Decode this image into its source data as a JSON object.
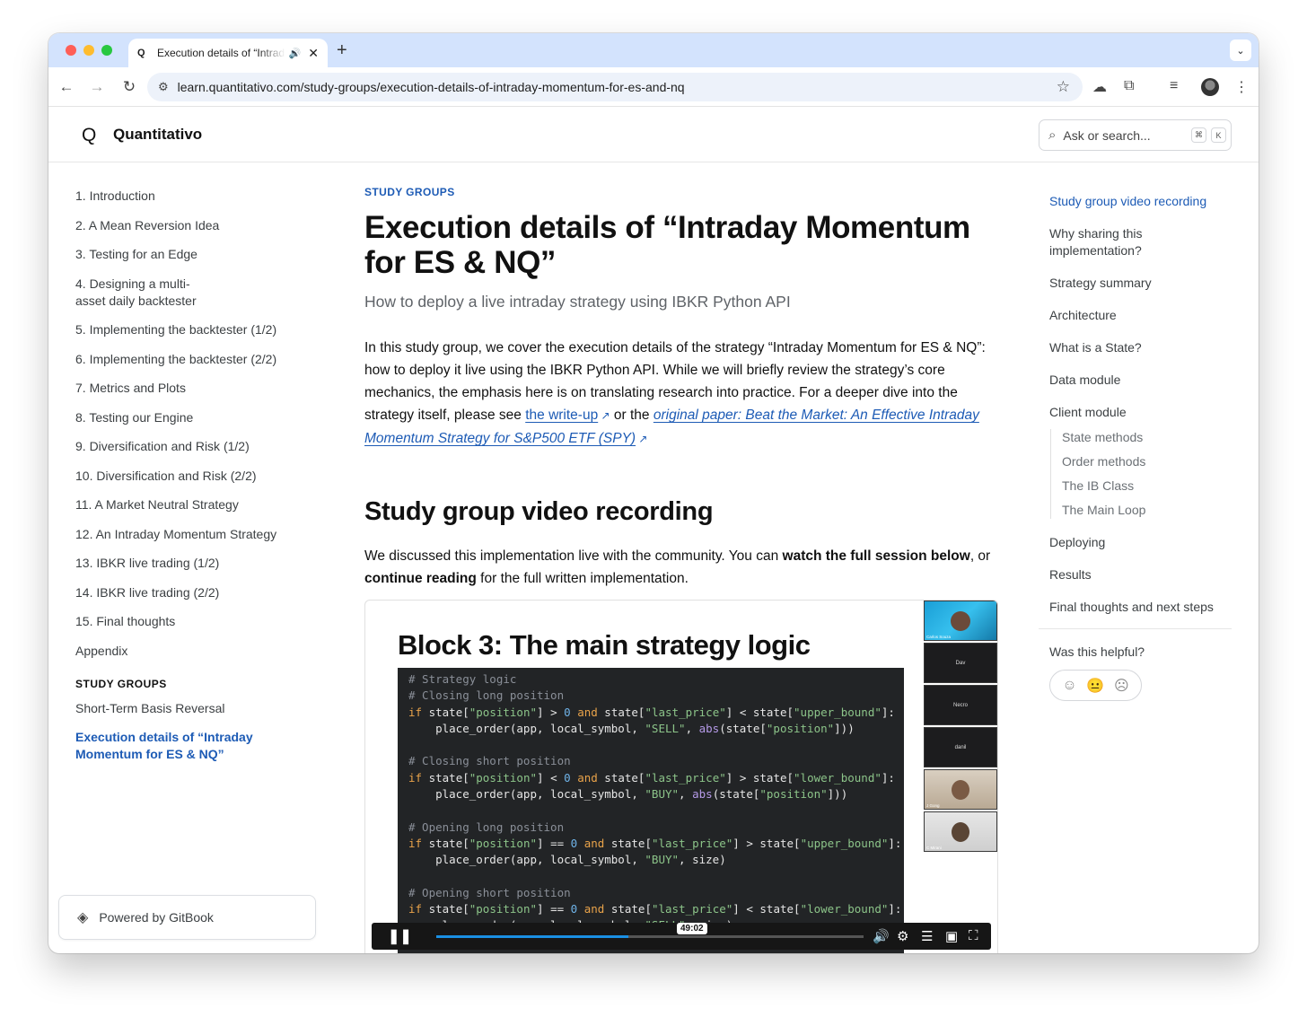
{
  "browser": {
    "tab_favicon": "Q",
    "tab_title": "Execution details of “Intraday Momentum",
    "url": "learn.quantitativo.com/study-groups/execution-details-of-intraday-momentum-for-es-and-nq",
    "icons": [
      "back-icon",
      "forward-icon",
      "reload-icon",
      "tune-icon",
      "star-icon",
      "cloud-icon",
      "extensions-icon",
      "media-icon",
      "profile-avatar",
      "menu-icon"
    ]
  },
  "site": {
    "logo": "Q",
    "name": "Quantitativo",
    "search_placeholder": "Ask or search...",
    "shortcut_keys": [
      "⌘",
      "K"
    ]
  },
  "sidebar": {
    "items": [
      "1. Introduction",
      "2. A Mean Reversion Idea",
      "3. Testing for an Edge",
      "4. Designing a multi-asset daily backtester",
      "5. Implementing the backtester (1/2)",
      "6. Implementing the backtester (2/2)",
      "7. Metrics and Plots",
      "8. Testing our Engine",
      "9. Diversification and Risk (1/2)",
      "10. Diversification and Risk (2/2)",
      "11. A Market Neutral Strategy",
      "12. An Intraday Momentum Strategy",
      "13. IBKR live trading (1/2)",
      "14. IBKR live trading (2/2)",
      "15. Final thoughts",
      "Appendix"
    ],
    "item4_line1": "4. Designing a multi-",
    "item4_line2": "asset daily backtester",
    "section_title": "STUDY GROUPS",
    "study_groups": [
      "Short-Term Basis Reversal",
      "Execution details of “Intraday Momentum for ES & NQ”"
    ],
    "active_line1": "Execution details of “Intraday",
    "active_line2": "Momentum for ES & NQ”",
    "powered_by": "Powered by GitBook"
  },
  "main": {
    "kicker": "STUDY GROUPS",
    "title": "Execution details of “Intraday Momentum for ES & NQ”",
    "subtitle": "How to deploy a live intraday strategy using IBKR Python API",
    "intro_part1": "In this study group, we cover the execution details of the strategy “Intraday Momentum for ES & NQ”: how to deploy it live using the IBKR Python API. While we will briefly review the strategy’s core mechanics, the emphasis here is on translating research into practice. For a deeper dive into the strategy itself, please see ",
    "link1": "the write-up",
    "intro_part2": " or the ",
    "link2": "original paper: Beat the Market: An Effective Intraday Momentum Strategy for S&P500 ETF (SPY)",
    "section_heading": "Study group video recording",
    "video_para_1": "We discussed this implementation live with the community. You can ",
    "video_bold_1": "watch the full session below",
    "video_para_2": ", or ",
    "video_bold_2": "continue reading",
    "video_para_3": " for the full written implementation."
  },
  "video": {
    "slide_title": "Block 3: The main strategy logic",
    "participants": [
      {
        "name": "Carlos Souza",
        "label": ""
      },
      {
        "name": "",
        "label": "Dav"
      },
      {
        "name": "",
        "label": "Necro"
      },
      {
        "name": "",
        "label": "danil"
      },
      {
        "name": "J Gong",
        "label": ""
      },
      {
        "name": "C Mirani",
        "label": ""
      }
    ],
    "timestamp": "49:02",
    "progress": 0.45,
    "controls": [
      "pause-icon",
      "volume-icon",
      "settings-icon",
      "chapters-icon",
      "pip-icon",
      "fullscreen-icon"
    ]
  },
  "toc": {
    "items": [
      "Study group video recording",
      "Why sharing this implementation?",
      "Strategy summary",
      "Architecture",
      "What is a State?",
      "Data module",
      "Client module"
    ],
    "sub_items": [
      "State methods",
      "Order methods",
      "The IB Class",
      "The Main Loop"
    ],
    "items_after": [
      "Deploying",
      "Results",
      "Final thoughts and next steps"
    ],
    "why_line1": "Why sharing this",
    "why_line2": "implementation?",
    "helpful": "Was this helpful?"
  }
}
